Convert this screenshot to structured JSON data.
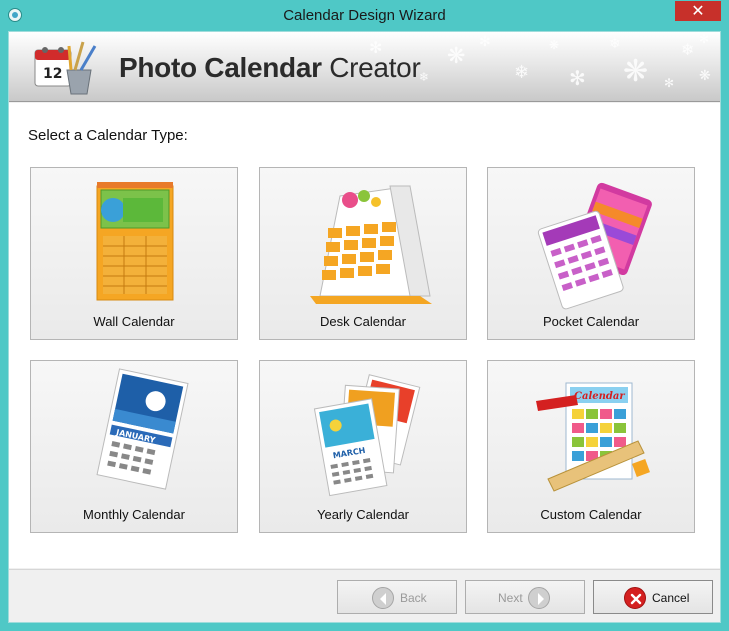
{
  "window": {
    "title": "Calendar Design Wizard",
    "close_glyph": "✕"
  },
  "banner": {
    "app_name_bold": "Photo Calendar",
    "app_name_rest": "Creator"
  },
  "content": {
    "prompt": "Select a Calendar Type:",
    "tiles": [
      {
        "label": "Wall Calendar",
        "icon": "wall-calendar-icon"
      },
      {
        "label": "Desk Calendar",
        "icon": "desk-calendar-icon"
      },
      {
        "label": "Pocket Calendar",
        "icon": "pocket-calendar-icon"
      },
      {
        "label": "Monthly Calendar",
        "icon": "monthly-calendar-icon",
        "month_text": "JANUARY"
      },
      {
        "label": "Yearly Calendar",
        "icon": "yearly-calendar-icon",
        "month_text": "MARCH"
      },
      {
        "label": "Custom Calendar",
        "icon": "custom-calendar-icon",
        "header_text": "Calendar"
      }
    ]
  },
  "footer": {
    "back_label": "Back",
    "next_label": "Next",
    "cancel_label": "Cancel"
  },
  "colors": {
    "frame": "#4fc8c6",
    "close": "#c7302a",
    "cancel_icon": "#d42020"
  }
}
